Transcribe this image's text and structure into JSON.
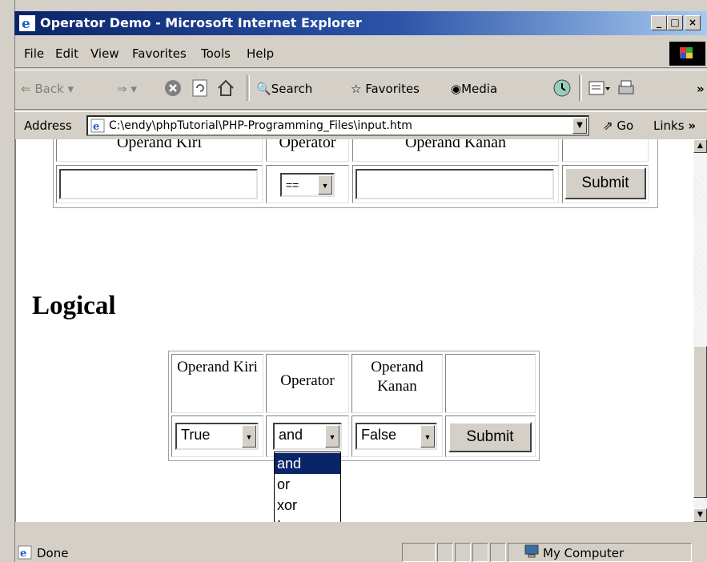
{
  "window": {
    "title": "Operator Demo - Microsoft Internet Explorer",
    "controls": [
      "_",
      "□",
      "×"
    ]
  },
  "menu": {
    "items": [
      "File",
      "Edit",
      "View",
      "Favorites",
      "Tools",
      "Help"
    ]
  },
  "toolbar": {
    "back": "Back",
    "search": "Search",
    "favorites": "Favorites",
    "media": "Media",
    "more": "»"
  },
  "address": {
    "label": "Address",
    "value": "C:\\endy\\phpTutorial\\PHP-Programming_Files\\input.htm",
    "go": "Go",
    "links": "Links",
    "more": "»"
  },
  "comparison": {
    "headers": [
      "Operand Kiri",
      "Operator",
      "Operand Kanan",
      ""
    ],
    "operator_value": "==",
    "submit": "Submit"
  },
  "logical": {
    "heading": "Logical",
    "headers": [
      "Operand Kiri",
      "Operator",
      "Operand Kanan",
      ""
    ],
    "left_value": "True",
    "operator_value": "and",
    "right_value": "False",
    "submit": "Submit",
    "operator_options": [
      "and",
      "or",
      "xor",
      "!"
    ],
    "selected_option": "and"
  },
  "status": {
    "text": "Done",
    "zone": "My Computer"
  },
  "colors": {
    "titlebar": "#0a246a",
    "chrome": "#d4d0c8",
    "selection": "#0a246a"
  }
}
